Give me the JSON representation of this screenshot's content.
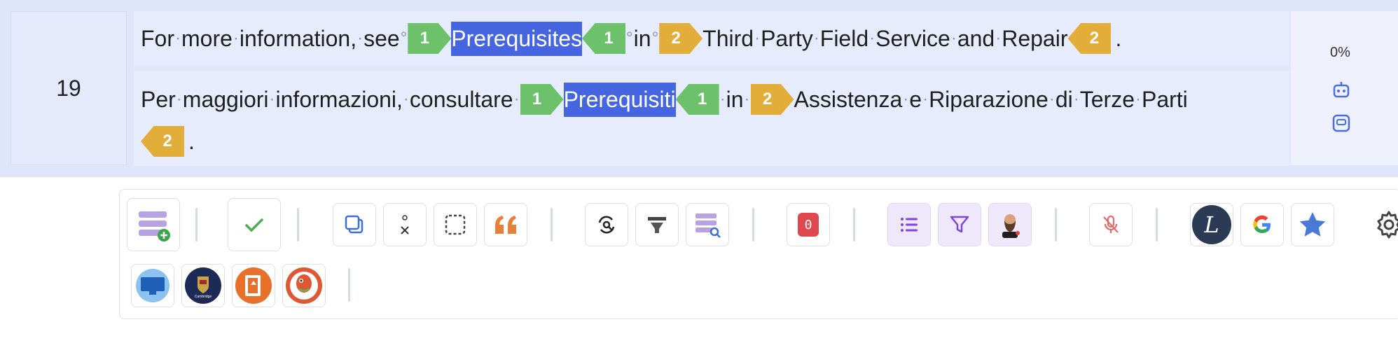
{
  "segment": {
    "number": "19",
    "source": {
      "p1": "For",
      "p2": "more",
      "p3": "information,",
      "p4": "see",
      "tag1": "1",
      "highlight": "Prerequisites",
      "tag1b": "1",
      "p5": "in",
      "tag2": "2",
      "p6": "Third",
      "p7": "Party",
      "p8": "Field",
      "p9": "Service",
      "p10": "and",
      "p11": "Repair",
      "tag2b": "2",
      "end": "."
    },
    "target": {
      "p1": "Per",
      "p2": "maggiori",
      "p3": "informazioni,",
      "p4": "consultare",
      "tag1": "1",
      "highlight": "Prerequisiti",
      "tag1b": "1",
      "p5": "in",
      "tag2": "2",
      "p6": "Assistenza",
      "p7": "e",
      "p8": "Riparazione",
      "p9": "di",
      "p10": "Terze",
      "p11": "Parti",
      "tag2b": "2",
      "end": "."
    },
    "status": {
      "percent": "0%"
    }
  },
  "toolbar": {
    "error_count": "0"
  },
  "colors": {
    "highlight": "#4566e0",
    "tag_green": "#6cc16a",
    "tag_gold": "#e3ad3a",
    "row_bg": "#dfe6fb"
  }
}
